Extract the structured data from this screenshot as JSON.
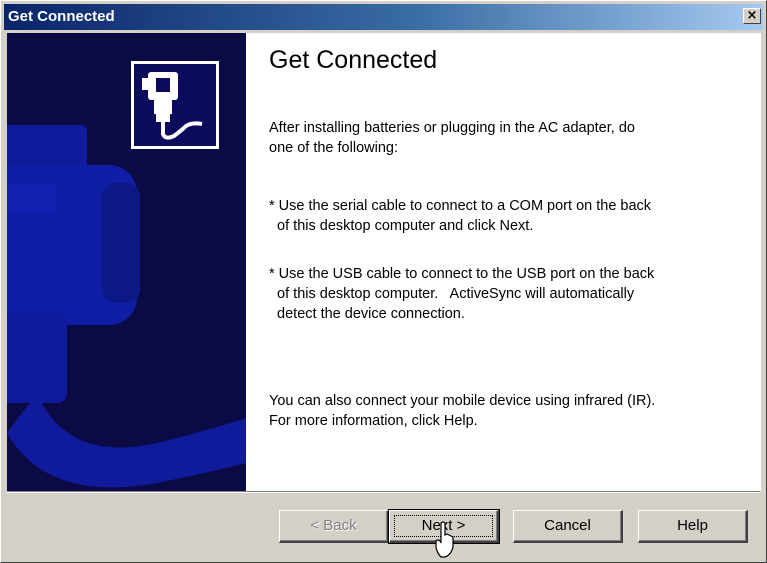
{
  "window": {
    "title": "Get Connected",
    "close_glyph": "×"
  },
  "header": {
    "icon": "connect-cable-icon"
  },
  "main": {
    "title": "Get Connected",
    "intro": "After installing batteries or plugging in the AC adapter, do\none of the following:",
    "serial": "* Use the serial cable to connect to a COM port on the back\n  of this desktop computer and click Next.",
    "usb": "* Use the USB cable to connect to the USB port on the back\n  of this desktop computer.   ActiveSync will automatically\n  detect the device connection.",
    "infrared": "You can also connect your mobile device using infrared (IR).\nFor more information, click Help."
  },
  "buttons": {
    "back": "< Back",
    "next": "Next >",
    "cancel": "Cancel",
    "help": "Help"
  },
  "colors": {
    "title_bar": "#0a246a",
    "side_panel": "#0a0a44",
    "side_shape": "#0f1b9a"
  }
}
